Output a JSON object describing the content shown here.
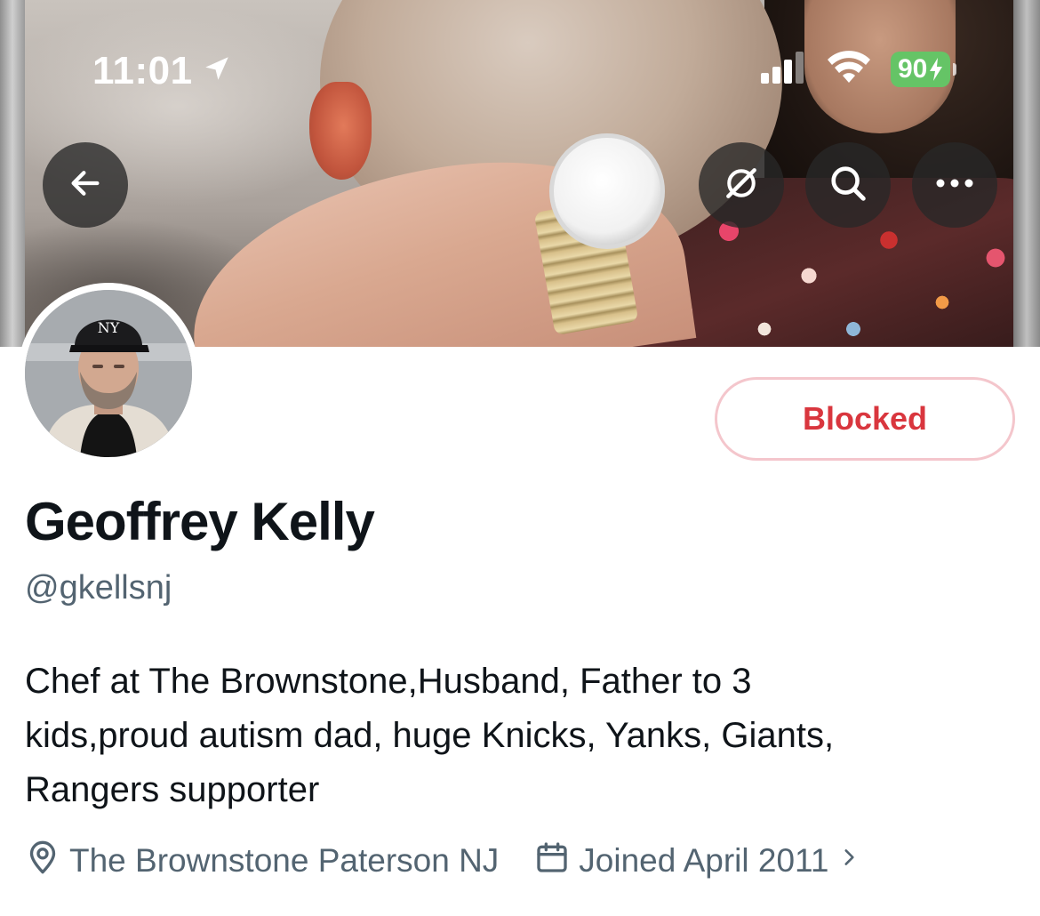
{
  "status_bar": {
    "time": "11:01",
    "battery": "90",
    "icons": [
      "location-arrow-icon",
      "cellular-signal-icon",
      "wifi-icon",
      "battery-charging-icon"
    ],
    "battery_color": "#65c466"
  },
  "header": {
    "back_icon": "arrow-left-icon",
    "actions": [
      "grok-icon",
      "search-icon",
      "more-icon"
    ]
  },
  "profile": {
    "display_name": "Geoffrey Kelly",
    "handle": "@gkellsnj",
    "follow_state_label": "Blocked",
    "bio_lines": [
      "Chef at The Brownstone,Husband, Father to 3",
      "kids,proud autism dad, huge Knicks, Yanks, Giants,",
      "Rangers supporter"
    ],
    "location": "The Brownstone Paterson NJ",
    "joined": "Joined April 2011"
  },
  "colors": {
    "blocked_text": "#d9363e",
    "blocked_border": "#f4c6cc",
    "secondary_text": "#536471",
    "primary_text": "#0f1419"
  }
}
